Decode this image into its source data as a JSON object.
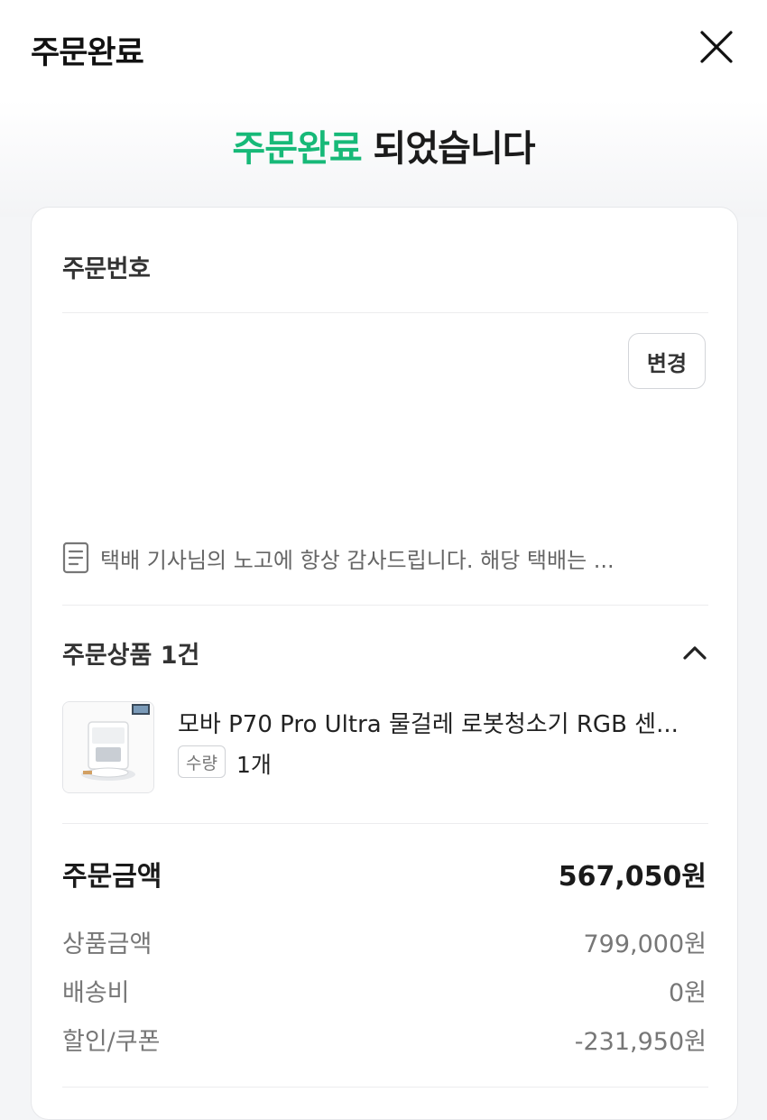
{
  "header": {
    "title": "주문완료",
    "close_icon": "close-icon"
  },
  "hero": {
    "accent_text": "주문완료",
    "rest_text": " 되었습니다",
    "accent_color": "#17b978"
  },
  "order": {
    "number_label": "주문번호",
    "change_label": "변경",
    "memo_icon": "document-icon",
    "memo_text": "택배 기사님의 노고에 항상 감사드립니다. 해당 택배는 ..."
  },
  "products": {
    "section_title": "주문상품 1건",
    "toggle_icon": "chevron-up-icon",
    "items": [
      {
        "name": "모바 P70 Pro Ultra 물걸레 로봇청소기 RGB 센...",
        "qty_label": "수량",
        "qty_value": "1개",
        "thumbnail_icon": "robot-vacuum-image"
      }
    ]
  },
  "summary": {
    "total_label": "주문금액",
    "total_value": "567,050원",
    "rows": [
      {
        "label": "상품금액",
        "value": "799,000원"
      },
      {
        "label": "배송비",
        "value": "0원"
      },
      {
        "label": "할인/쿠폰",
        "value": "-231,950원"
      }
    ]
  }
}
